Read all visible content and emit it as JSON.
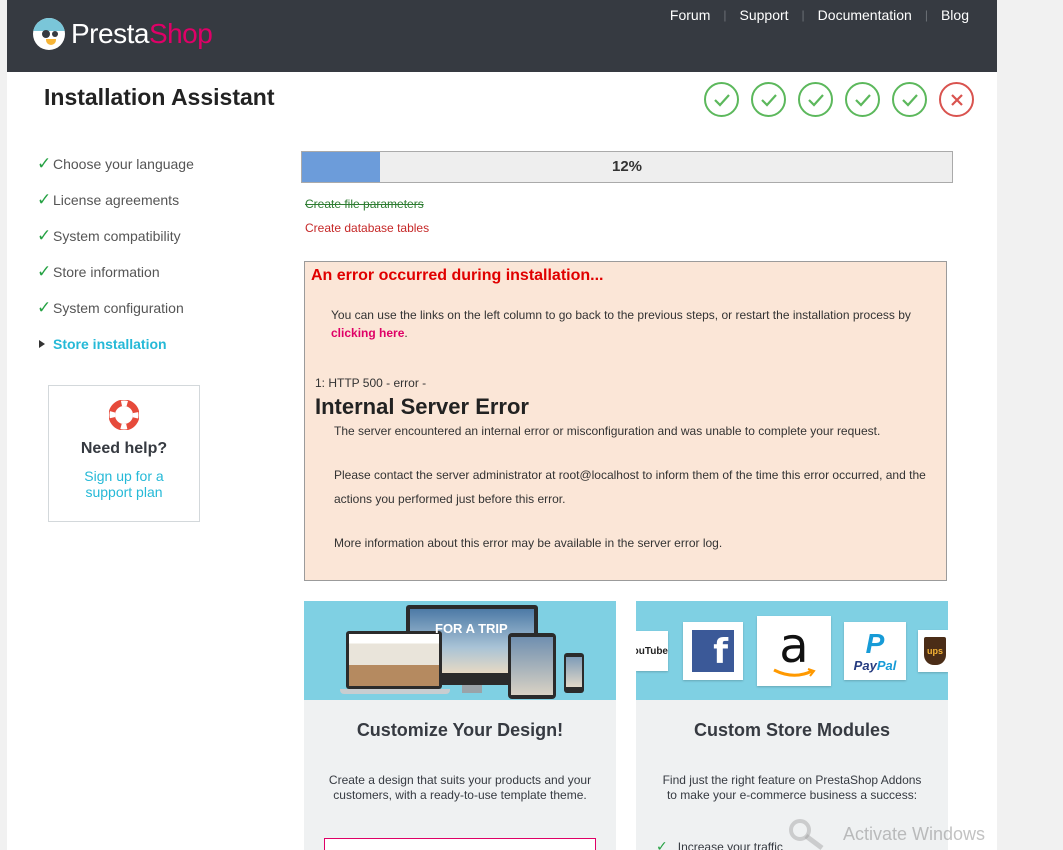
{
  "header": {
    "logo": {
      "presta": "Presta",
      "shop": "Shop"
    },
    "nav": [
      "Forum",
      "Support",
      "Documentation",
      "Blog"
    ]
  },
  "title": "Installation Assistant",
  "steps_status": [
    "done",
    "done",
    "done",
    "done",
    "done",
    "error"
  ],
  "colors": {
    "header_bg": "#363a41",
    "brand_pink": "#df0067",
    "accent_cyan": "#25b9d7",
    "success": "#5cb85c",
    "error": "#d9534f"
  },
  "sidebar": {
    "items": [
      {
        "label": "Choose your language",
        "state": "done"
      },
      {
        "label": "License agreements",
        "state": "done"
      },
      {
        "label": "System compatibility",
        "state": "done"
      },
      {
        "label": "Store information",
        "state": "done"
      },
      {
        "label": "System configuration",
        "state": "done"
      },
      {
        "label": "Store installation",
        "state": "current"
      }
    ]
  },
  "help": {
    "icon": "lifebuoy-icon",
    "title": "Need help?",
    "link": "Sign up for a support plan"
  },
  "progress": {
    "value": 0.12,
    "label": "12%"
  },
  "tasks": {
    "done": "Create file parameters",
    "failed": "Create database tables"
  },
  "error": {
    "heading": "An error occurred during installation...",
    "intro_before": "You can use the links on the left column to go back to the previous steps, or restart the installation process by ",
    "intro_link": "clicking here",
    "intro_after": ".",
    "code": "1: HTTP 500 - error -",
    "title": "Internal Server Error",
    "p1": "The server encountered an internal error or misconfiguration and was unable to complete your request.",
    "p2": "Please contact the server administrator at root@localhost to inform them of the time this error occurred, and the actions you performed just before this error.",
    "p3": "More information about this error may be available in the server error log."
  },
  "promo": {
    "design": {
      "banner_caption": "FOR A TRIP",
      "title": "Customize Your Design!",
      "text": "Create a design that suits your products and your customers, with a ready-to-use template theme."
    },
    "modules": {
      "brands": {
        "youtube": "YouTube",
        "facebook": "f",
        "amazon": "a",
        "paypal_1": "Pay",
        "paypal_2": "Pal",
        "ups": "ups"
      },
      "title": "Custom Store Modules",
      "text": "Find just the right feature on PrestaShop Addons to make your e-commerce business a success:",
      "feature": "Increase your traffic"
    }
  },
  "watermark": "Activate Windows"
}
